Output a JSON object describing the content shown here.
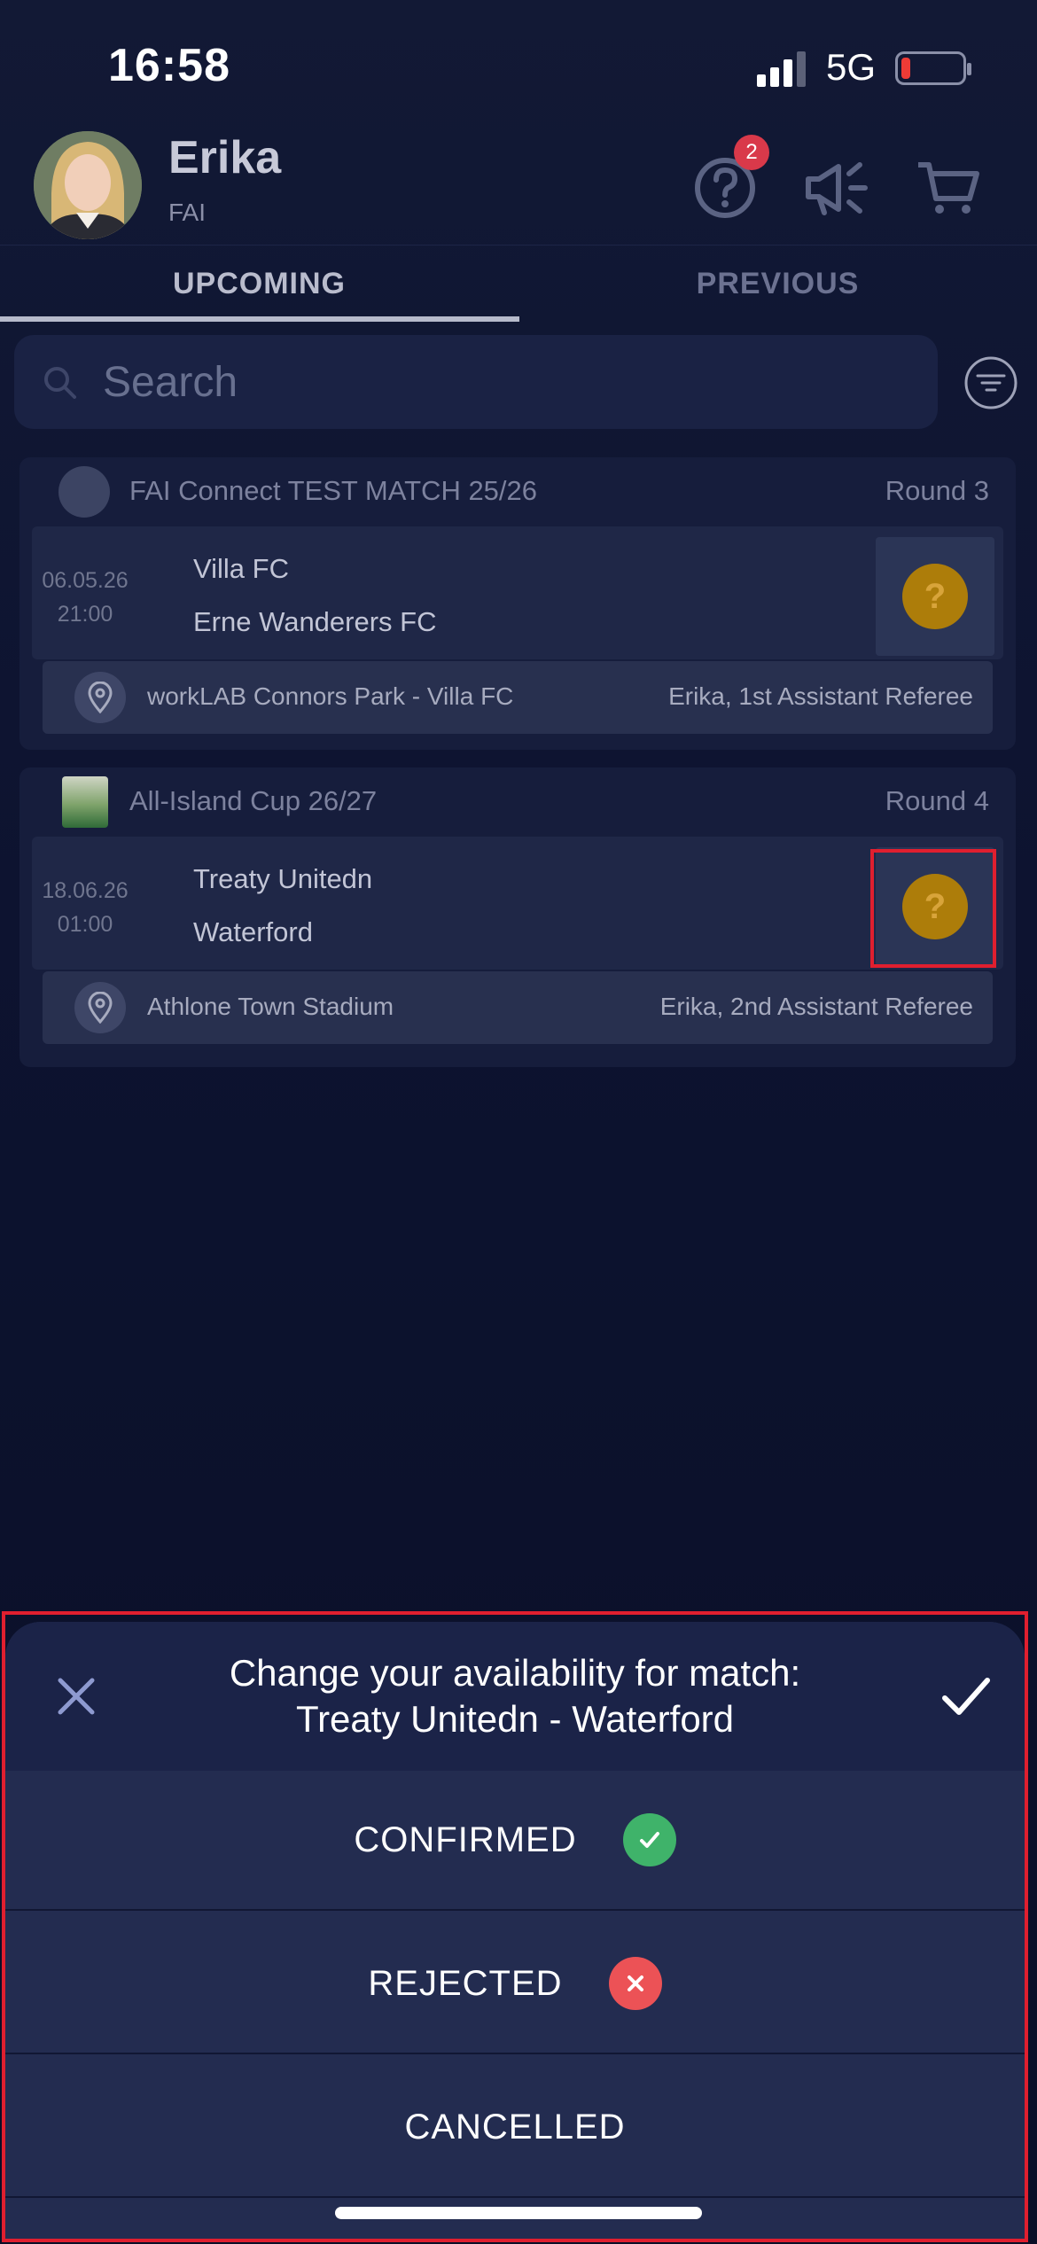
{
  "status_bar": {
    "time": "16:58",
    "network": "5G"
  },
  "header": {
    "user_name": "Erika",
    "org": "FAI",
    "help_badge": "2"
  },
  "tabs": [
    {
      "label": "UPCOMING",
      "active": true
    },
    {
      "label": "PREVIOUS",
      "active": false
    }
  ],
  "search": {
    "placeholder": "Search"
  },
  "matches": [
    {
      "competition": "FAI Connect TEST MATCH 25/26",
      "round": "Round 3",
      "date": "06.05.26",
      "time": "21:00",
      "home": "Villa FC",
      "away": "Erne Wanderers FC",
      "status_symbol": "?",
      "venue": "workLAB Connors Park - Villa FC",
      "role": "Erika, 1st Assistant Referee"
    },
    {
      "competition": "All-Island Cup 26/27",
      "round": "Round 4",
      "date": "18.06.26",
      "time": "01:00",
      "home": "Treaty Unitedn",
      "away": "Waterford",
      "status_symbol": "?",
      "venue": "Athlone Town Stadium",
      "role": "Erika, 2nd Assistant Referee"
    }
  ],
  "sheet": {
    "title_line1": "Change your availability for match:",
    "title_line2": "Treaty Unitedn - Waterford",
    "options": [
      {
        "label": "CONFIRMED"
      },
      {
        "label": "REJECTED"
      },
      {
        "label": "CANCELLED"
      }
    ]
  },
  "colors": {
    "background": "#0d1330",
    "pending_status": "#ad7d0a",
    "confirmed": "#3fb36a",
    "rejected": "#ec5256",
    "highlight": "#e01f2f"
  },
  "icons": [
    "help-icon",
    "megaphone-icon",
    "cart-icon",
    "search-icon",
    "filter-icon",
    "location-pin-icon",
    "close-icon",
    "checkmark-icon"
  ]
}
